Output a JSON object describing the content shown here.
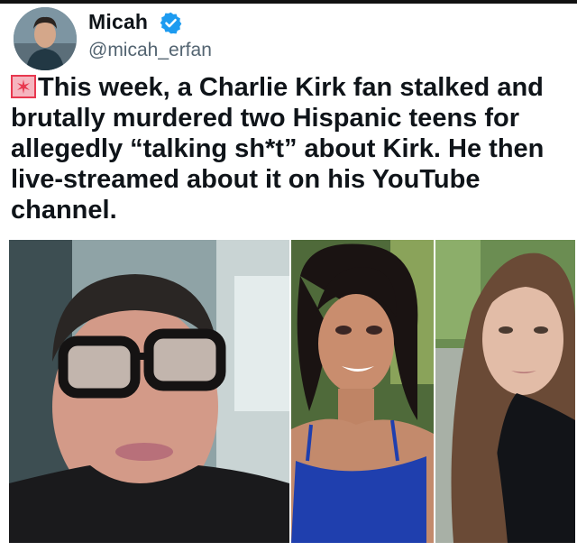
{
  "author": {
    "name": "Micah",
    "handle": "@micah_erfan",
    "avatar_icon": "user-avatar",
    "verified_icon": "verified-badge-icon",
    "verified_color": "#1d9bf0"
  },
  "tweet": {
    "leading_emoji_icon": "rotating-light-icon",
    "text": "This week, a Charlie Kirk fan stalked and brutally murdered two Hispanic teens for allegedly “talking sh*t” about Kirk. He then live-streamed about it on his YouTube channel."
  },
  "media": {
    "photos": [
      {
        "description_icon": "photo-young-man-glasses"
      },
      {
        "description_icon": "photo-teen-girl-blue-top"
      },
      {
        "description_icon": "photo-teen-girl-long-hair"
      }
    ]
  }
}
